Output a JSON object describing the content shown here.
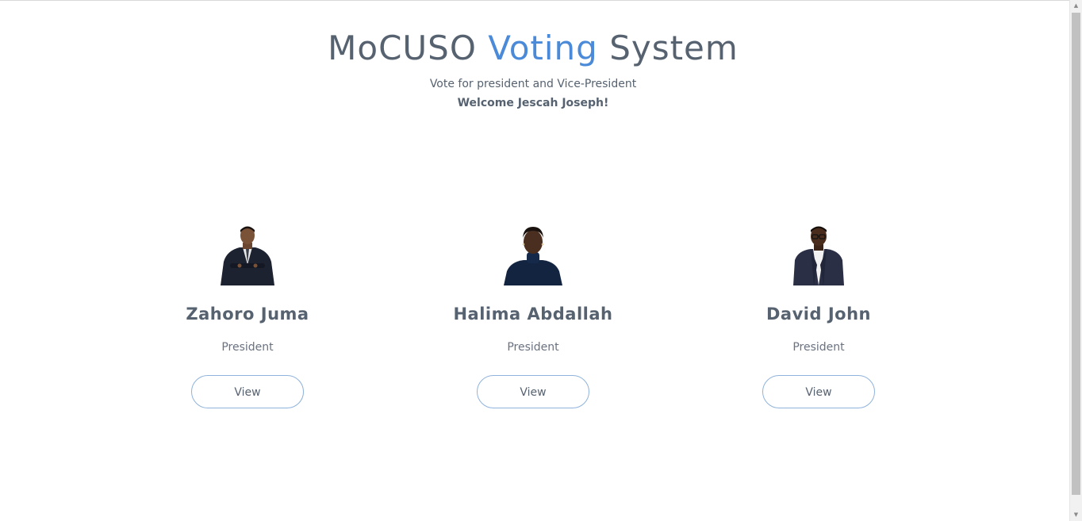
{
  "header": {
    "title_part1": "MoCUSO ",
    "title_part2": "Voting",
    "title_part3": " System",
    "subtitle": "Vote for president and Vice-President",
    "welcome": "Welcome Jescah Joseph!"
  },
  "candidates": [
    {
      "name": "Zahoro Juma",
      "role": "President",
      "button": "View",
      "photo_icon": "man-in-suit-photo"
    },
    {
      "name": "Halima Abdallah",
      "role": "President",
      "button": "View",
      "photo_icon": "woman-in-turtleneck-photo"
    },
    {
      "name": "David John",
      "role": "President",
      "button": "View",
      "photo_icon": "man-with-glasses-photo"
    }
  ],
  "colors": {
    "text": "#566270",
    "accent": "#4a8ad8",
    "button_border": "#8fb3dc"
  }
}
